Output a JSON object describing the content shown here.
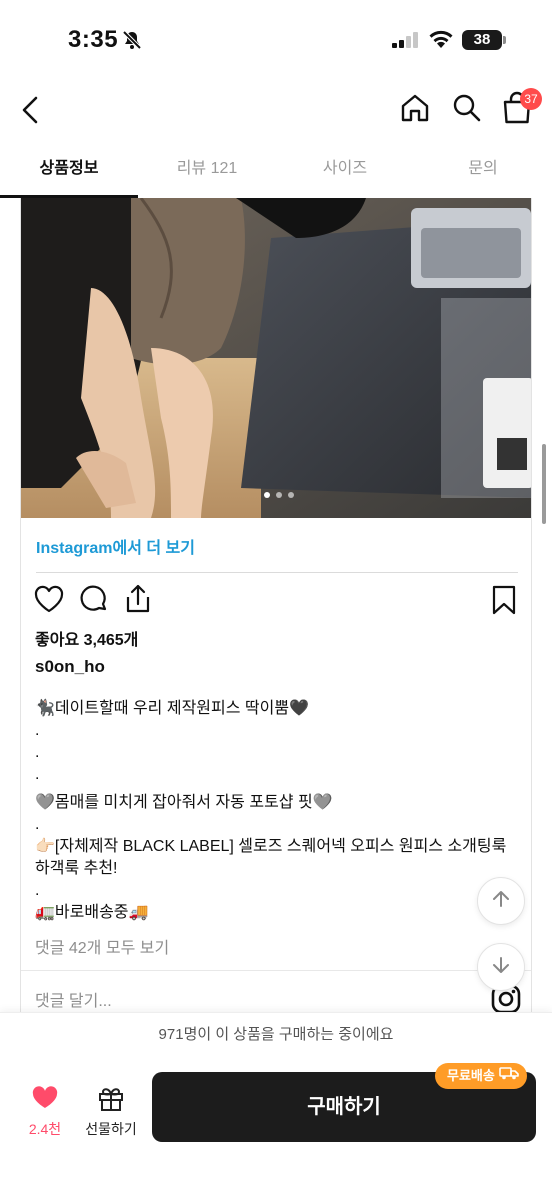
{
  "status_bar": {
    "time": "3:35",
    "battery": "38"
  },
  "nav": {
    "cart_count": "37"
  },
  "tabs": [
    {
      "label": "상품정보",
      "active": true
    },
    {
      "label": "리뷰 121",
      "active": false
    },
    {
      "label": "사이즈",
      "active": false
    },
    {
      "label": "문의",
      "active": false
    }
  ],
  "instagram": {
    "view_more": "Instagram에서 더 보기",
    "likes": "좋아요 3,465개",
    "username": "s0on_ho",
    "caption": [
      "🐈‍⬛데이트할때 우리 제작원피스 딱이뿜🖤",
      ".",
      ".",
      ".",
      "🩶몸매를 미치게 잡아줘서 자동 포토샵 핏🩶",
      ".",
      "👉🏻[자체제작 BLACK LABEL] 셀로즈 스퀘어넥 오피스 원피스 소개팅룩 하객룩 추천!",
      ".",
      "🚛바로배송중🚚"
    ],
    "view_comments": "댓글 42개 모두 보기",
    "add_comment_placeholder": "댓글 달기..."
  },
  "bottom": {
    "notice": "971명이 이 상품을 구매하는 중이에요",
    "like_count": "2.4천",
    "gift_label": "선물하기",
    "buy_label": "구매하기",
    "free_shipping_badge": "무료배송"
  },
  "colors": {
    "accent_link": "#1e9ad6",
    "like_red": "#ff4b6a",
    "badge_orange": "#ff9c27",
    "buy_dark": "#1c1c1c"
  }
}
